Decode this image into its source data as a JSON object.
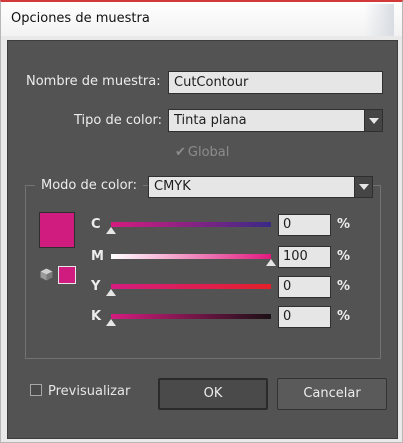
{
  "window": {
    "title": "Opciones de muestra"
  },
  "form": {
    "name_label": "Nombre de muestra:",
    "name_value": "CutContour",
    "color_type_label": "Tipo de color:",
    "color_type_value": "Tinta plana",
    "global_label": "Global",
    "global_checked": true,
    "global_enabled": false
  },
  "color_mode": {
    "label": "Modo de color:",
    "value": "CMYK",
    "swatch_color": "#d01b7f",
    "channels": [
      {
        "name": "C",
        "value": "0",
        "unit": "%",
        "gradient": [
          "#d51c80",
          "#3b2a87"
        ],
        "level": 0
      },
      {
        "name": "M",
        "value": "100",
        "unit": "%",
        "gradient": [
          "#ffffff",
          "#e0197f"
        ],
        "level": 100
      },
      {
        "name": "Y",
        "value": "0",
        "unit": "%",
        "gradient": [
          "#d51c80",
          "#e3202a"
        ],
        "level": 0
      },
      {
        "name": "K",
        "value": "0",
        "unit": "%",
        "gradient": [
          "#d51c80",
          "#1a1014"
        ],
        "level": 0
      }
    ]
  },
  "footer": {
    "preview_label": "Previsualizar",
    "preview_checked": false,
    "ok_label": "OK",
    "cancel_label": "Cancelar"
  }
}
